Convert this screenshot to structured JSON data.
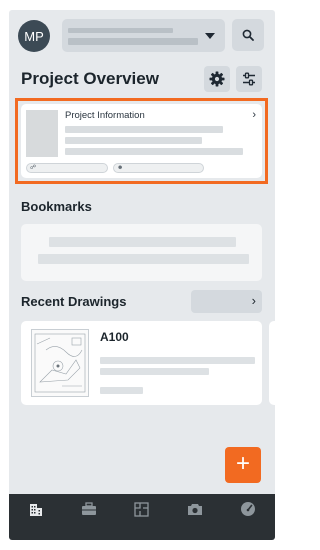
{
  "header": {
    "avatar_initials": "MP",
    "project_select_icon": "caret-down-icon",
    "search_icon": "search-icon"
  },
  "overview": {
    "title": "Project Overview",
    "settings_icon": "gear-icon",
    "customize_icon": "sliders-icon"
  },
  "project_info": {
    "title": "Project Information",
    "chevron": "›",
    "pill_icons": [
      "link-icon",
      "people-icon"
    ]
  },
  "bookmarks": {
    "title": "Bookmarks"
  },
  "recent_drawings": {
    "title": "Recent Drawings",
    "see_all_chevron": "›",
    "items": [
      {
        "number": "A100"
      }
    ]
  },
  "fab": {
    "label": "+"
  },
  "bottom_nav": {
    "items": [
      "buildings-icon",
      "briefcase-icon",
      "floorplan-icon",
      "camera-icon",
      "gauge-icon"
    ]
  },
  "colors": {
    "accent": "#f26a21",
    "nav_background": "#2b3034",
    "screen_background": "#e6e9ec"
  }
}
